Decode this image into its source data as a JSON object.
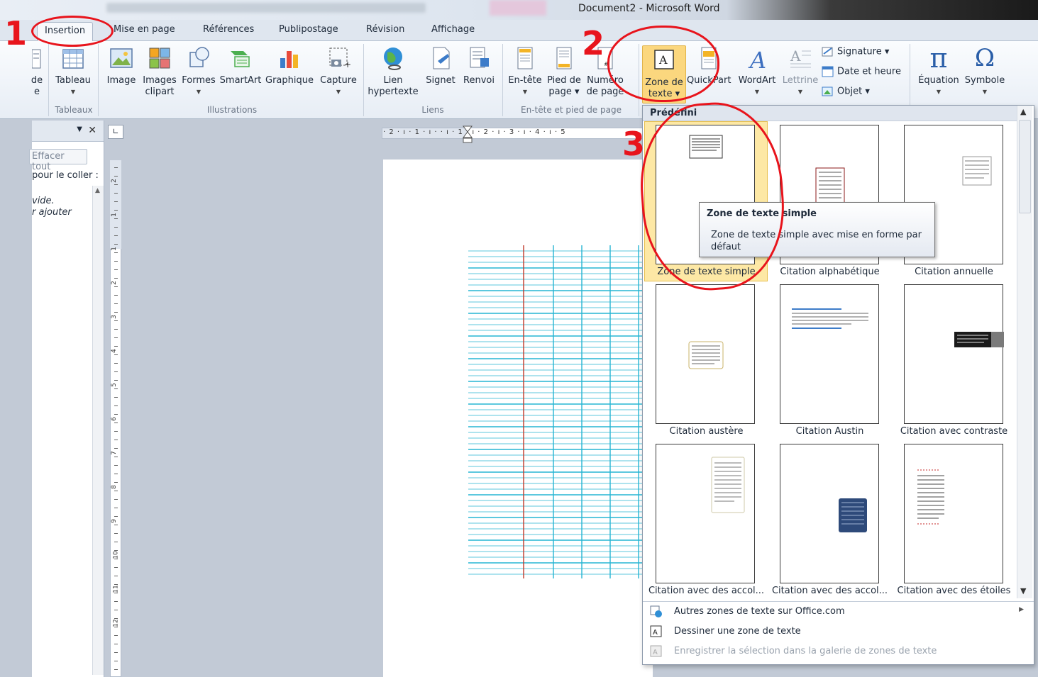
{
  "window": {
    "title": "Document2 - Microsoft Word"
  },
  "tabs": [
    "Insertion",
    "Mise en page",
    "Références",
    "Publipostage",
    "Révision",
    "Affichage"
  ],
  "ribbon": {
    "partial_left": [
      "de",
      "e"
    ],
    "tableau": "Tableau",
    "image": "Image",
    "images_clipart": [
      "Images",
      "clipart"
    ],
    "formes": "Formes",
    "smartart": "SmartArt",
    "graphique": "Graphique",
    "capture": "Capture",
    "lien": [
      "Lien",
      "hypertexte"
    ],
    "signet": "Signet",
    "renvoi": "Renvoi",
    "entete": "En-tête",
    "pied": [
      "Pied de",
      "page"
    ],
    "numero": [
      "Numéro",
      "de page"
    ],
    "zone": [
      "Zone de",
      "texte"
    ],
    "quickpart": "QuickPart",
    "wordart": "WordArt",
    "lettrine": "Lettrine",
    "signature": "Signature",
    "date_heure": "Date et heure",
    "objet": "Objet",
    "equation": "Équation",
    "symbole": "Symbole",
    "equation_glyph": "π",
    "symbole_glyph": "Ω",
    "groups": {
      "tableaux": "Tableaux",
      "illustrations": "Illustrations",
      "liens": "Liens",
      "entete_pied": "En-tête et pied de page"
    }
  },
  "left_pane": {
    "button": "Effacer tout",
    "line1": "pour le coller :",
    "line2": "vide.",
    "line3": "r ajouter"
  },
  "ruler": {
    "h_numbers": "· 2 · ı · 1 · ı ·   · ı · 1 · ı · 2 · ı · 3 · ı · 4 · ı · 5",
    "v_numbers": [
      "2",
      "1",
      "1",
      "2",
      "3",
      "4",
      "5",
      "6",
      "7",
      "8",
      "9",
      "10",
      "11",
      "12"
    ]
  },
  "gallery": {
    "header": "Prédéfini",
    "items": [
      "Zone de texte simple",
      "Citation alphabétique",
      "Citation annuelle",
      "Citation austère",
      "Citation Austin",
      "Citation avec contraste",
      "Citation avec des accol...",
      "Citation avec des accol...",
      "Citation avec des étoiles"
    ],
    "menu": [
      "Autres zones de texte sur Office.com",
      "Dessiner une zone de texte",
      "Enregistrer la sélection dans la galerie de zones de texte"
    ]
  },
  "tooltip": {
    "title": "Zone de texte simple",
    "body": "Zone de texte simple avec mise en forme par défaut"
  },
  "annotations": [
    "1",
    "2",
    "3"
  ],
  "colors": {
    "annotation": "#e8141c",
    "grid_lines": "#27b5d3",
    "margin_line": "#c0392b",
    "selected": "#fde8a5"
  }
}
